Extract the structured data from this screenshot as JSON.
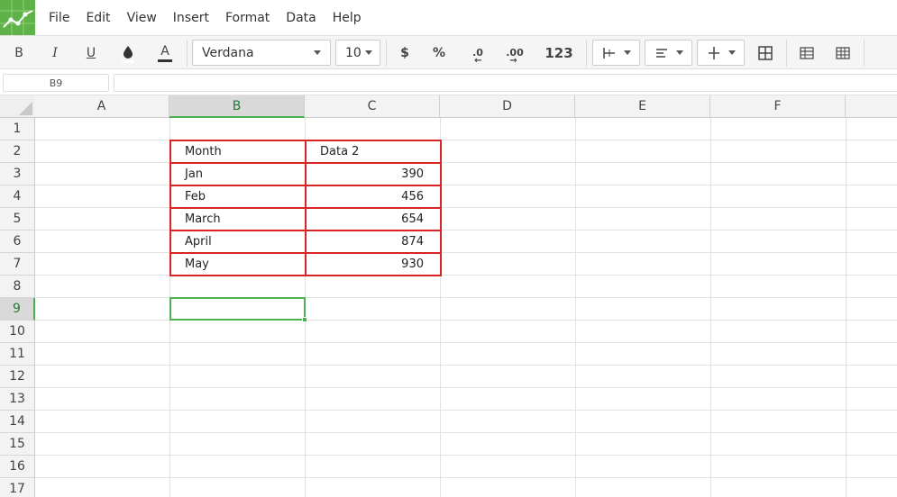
{
  "menu": {
    "items": [
      "File",
      "Edit",
      "View",
      "Insert",
      "Format",
      "Data",
      "Help"
    ]
  },
  "toolbar": {
    "bold": "B",
    "italic": "I",
    "underline": "U",
    "text_color": "A",
    "font_family": "Verdana",
    "font_size": "10",
    "currency": "$",
    "percent": "%",
    "decrease_decimal": ".0",
    "increase_decimal": ".00",
    "number_format": "123"
  },
  "formula_bar": {
    "cell_ref": "B9",
    "formula": ""
  },
  "columns": [
    "A",
    "B",
    "C",
    "D",
    "E",
    "F"
  ],
  "rows": [
    "1",
    "2",
    "3",
    "4",
    "5",
    "6",
    "7",
    "8",
    "9",
    "10",
    "11",
    "12",
    "13",
    "14",
    "15",
    "16",
    "17"
  ],
  "selected": {
    "column": "B",
    "row": "9"
  },
  "table": {
    "header": [
      "Month",
      "Data 2"
    ],
    "rows": [
      [
        "Jan",
        "390"
      ],
      [
        "Feb",
        "456"
      ],
      [
        "March",
        "654"
      ],
      [
        "April",
        "874"
      ],
      [
        "May",
        "930"
      ]
    ]
  },
  "colors": {
    "brand_green": "#5fb247",
    "selection_green": "#4caf50",
    "table_border_red": "#d92424"
  }
}
